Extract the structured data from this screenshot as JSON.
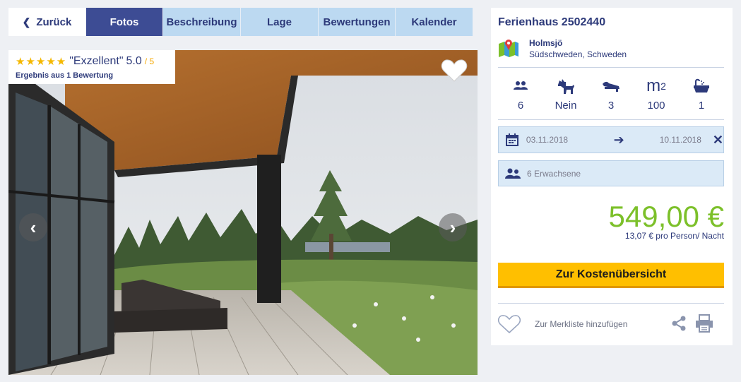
{
  "tabs": {
    "back": "Zurück",
    "items": [
      "Fotos",
      "Beschreibung",
      "Lage",
      "Bewertungen",
      "Kalender"
    ]
  },
  "rating": {
    "stars": "★★★★★",
    "label": "\"Exzellent\"",
    "score": "5.0",
    "out_of": "/ 5",
    "sub": "Ergebnis aus 1 Bewertung"
  },
  "listing": {
    "title": "Ferienhaus 2502440",
    "location_name": "Holmsjö",
    "location_region": "Südschweden, Schweden"
  },
  "features": {
    "persons": "6",
    "pets": "Nein",
    "bedrooms": "3",
    "area_unit": "m",
    "area_sup": "2",
    "area": "100",
    "bathrooms": "1"
  },
  "dates": {
    "from": "03.11.2018",
    "to": "10.11.2018"
  },
  "guests": {
    "text": "6 Erwachsene"
  },
  "price": {
    "amount": "549,00 €",
    "per_person": "13,07 € pro Person/ Nacht"
  },
  "cta": {
    "label": "Zur Kostenübersicht"
  },
  "actions": {
    "wishlist": "Zur Merkliste hinzufügen"
  },
  "colors": {
    "accent": "#3d4c94",
    "tab_bg": "#bcd9f1",
    "price": "#7cc02a",
    "cta": "#ffbf00",
    "star": "#f5b800"
  }
}
